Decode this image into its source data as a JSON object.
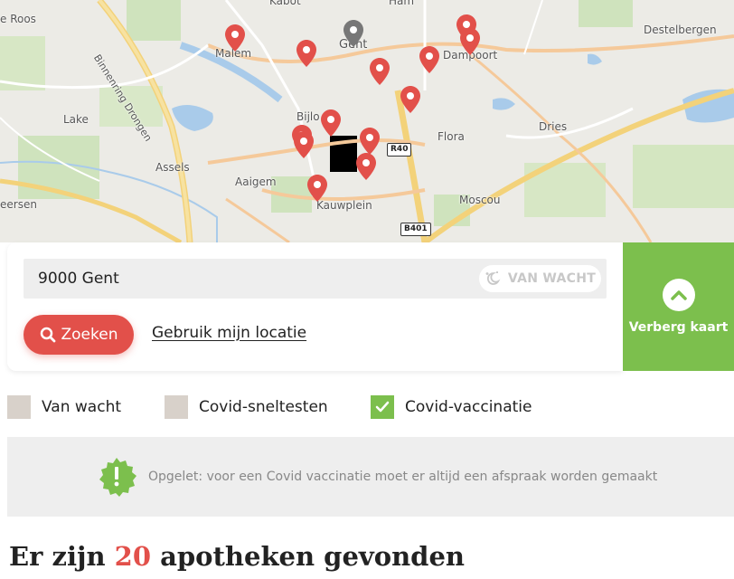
{
  "map": {
    "places": {
      "de_roos": "e Roos",
      "kabot": "Kabot",
      "ham": "Ham",
      "malem": "Malem",
      "gent": "Gent",
      "dampoort": "Dampoort",
      "destelbergen": "Destelbergen",
      "binnenring": "Binnenring Drongen",
      "lake": "Lake",
      "bijloke": "Bijlo",
      "flora": "Flora",
      "dries": "Dries",
      "assels": "Assels",
      "aaigem": "Aaigem",
      "moscou": "Moscou",
      "eersen": "eersen",
      "kauwplein": "Kauwplein"
    },
    "road_signs": {
      "r40": "R40",
      "b401": "B401"
    },
    "pin_color": "#e2504a",
    "center_pin_color": "#777777"
  },
  "search": {
    "value": "9000 Gent",
    "van_wacht_label": "VAN WACHT",
    "search_button": "Zoeken",
    "location_link": "Gebruik mijn locatie",
    "hide_map_label": "Verberg kaart"
  },
  "filters": [
    {
      "label": "Van wacht",
      "checked": false
    },
    {
      "label": "Covid-sneltesten",
      "checked": false
    },
    {
      "label": "Covid-vaccinatie",
      "checked": true
    }
  ],
  "notice": {
    "text": "Opgelet: voor een Covid vaccinatie moet er altijd een afspraak worden gemaakt",
    "icon": "exclamation-badge-icon"
  },
  "results": {
    "prefix": "Er zijn ",
    "count": "20",
    "suffix": " apotheken gevonden"
  },
  "colors": {
    "accent_red": "#e2504a",
    "accent_green": "#7cbf4d"
  }
}
